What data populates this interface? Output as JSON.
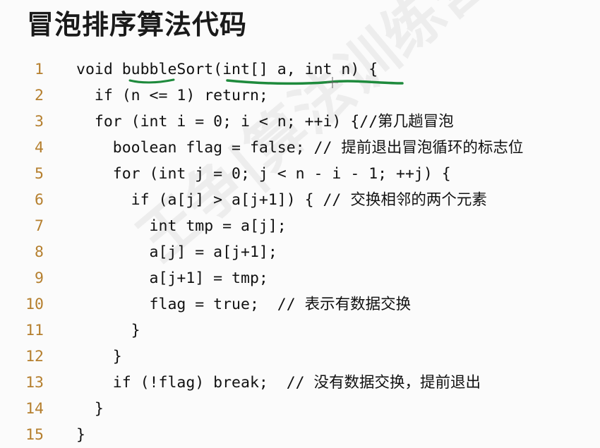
{
  "title": "冒泡排序算法代码",
  "watermark": "王争|算法训练营",
  "code": {
    "lines": [
      {
        "number": "1",
        "text": "void bubbleSort(int[] a, int n) {"
      },
      {
        "number": "2",
        "text": "  if (n <= 1) return;"
      },
      {
        "number": "3",
        "text": "  for (int i = 0; i < n; ++i) {//第几趟冒泡"
      },
      {
        "number": "4",
        "text": "    boolean flag = false; // 提前退出冒泡循环的标志位"
      },
      {
        "number": "5",
        "text": "    for (int j = 0; j < n - i - 1; ++j) {"
      },
      {
        "number": "6",
        "text": "      if (a[j] > a[j+1]) { // 交换相邻的两个元素"
      },
      {
        "number": "7",
        "text": "        int tmp = a[j];"
      },
      {
        "number": "8",
        "text": "        a[j] = a[j+1];"
      },
      {
        "number": "9",
        "text": "        a[j+1] = tmp;"
      },
      {
        "number": "10",
        "text": "        flag = true;  // 表示有数据交换"
      },
      {
        "number": "11",
        "text": "      }"
      },
      {
        "number": "12",
        "text": "    }"
      },
      {
        "number": "13",
        "text": "    if (!flag) break;  // 没有数据交换，提前退出"
      },
      {
        "number": "14",
        "text": "  }"
      },
      {
        "number": "15",
        "text": "}"
      }
    ]
  },
  "colors": {
    "line_number": "#b57f2e",
    "annotation": "#1e8a3c",
    "text": "#111111"
  }
}
